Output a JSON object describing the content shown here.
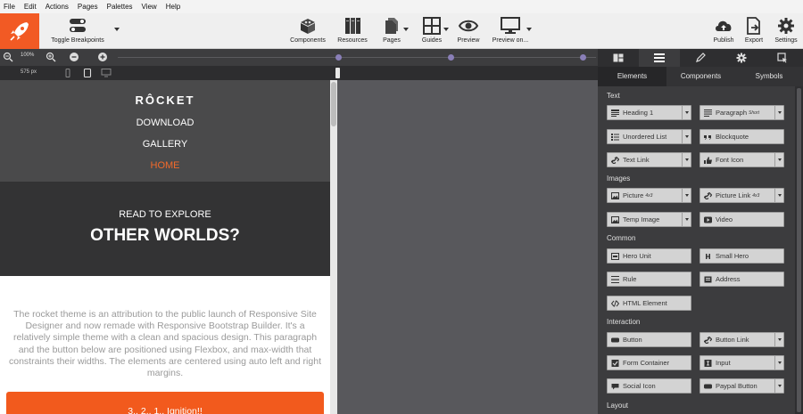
{
  "menu": [
    "File",
    "Edit",
    "Actions",
    "Pages",
    "Palettes",
    "View",
    "Help"
  ],
  "toolbar": {
    "toggle_breakpoints": "Toggle Breakpoints",
    "components": "Components",
    "resources": "Resources",
    "pages": "Pages",
    "guides": "Guides",
    "preview": "Preview",
    "preview_on": "Preview on...",
    "publish": "Publish",
    "export": "Export",
    "settings": "Settings"
  },
  "zoombar": {
    "zoom_level": "100%"
  },
  "widthbar": {
    "width": "575 px"
  },
  "preview": {
    "brand": "RÔCKET",
    "nav": [
      "DOWNLOAD",
      "GALLERY",
      "HOME"
    ],
    "hero_sub": "READ TO EXPLORE",
    "hero_title": "OTHER WORLDS?",
    "body": "The rocket theme is an attribution to the public launch of Responsive Site Designer and now remade with Responsive Bootstrap Builder. It's a relatively simple theme with a clean and spacious design. This paragraph and the button below are positioned using Flexbox, and max-width that constraints their widths. The elements are centered using auto left and right margins.",
    "cta": "3.. 2.. 1.. Ignition!!"
  },
  "panel": {
    "subtabs": [
      "Elements",
      "Components",
      "Symbols"
    ],
    "sections": {
      "text": "Text",
      "images": "Images",
      "common": "Common",
      "interaction": "Interaction",
      "layout": "Layout"
    },
    "elements": {
      "heading": "Heading 1",
      "paragraph": "Paragraph",
      "paragraph_short": "Short",
      "unordered_list": "Unordered List",
      "blockquote": "Blockquote",
      "text_link": "Text Link",
      "font_icon": "Font Icon",
      "picture": "Picture",
      "picture_ratio": "4x3",
      "picture_link": "Picture Link",
      "picture_link_ratio": "4x3",
      "temp_image": "Temp Image",
      "video": "Video",
      "hero_unit": "Hero Unit",
      "small_hero": "Small Hero",
      "rule": "Rule",
      "address": "Address",
      "html_element": "HTML Element",
      "button": "Button",
      "button_link": "Button Link",
      "form_container": "Form Container",
      "input": "Input",
      "social_icon": "Social Icon",
      "paypal_button": "Paypal Button"
    }
  },
  "colors": {
    "accent": "#f25a24",
    "panel": "#3c3c3e",
    "dot": "#8a7fb8"
  }
}
